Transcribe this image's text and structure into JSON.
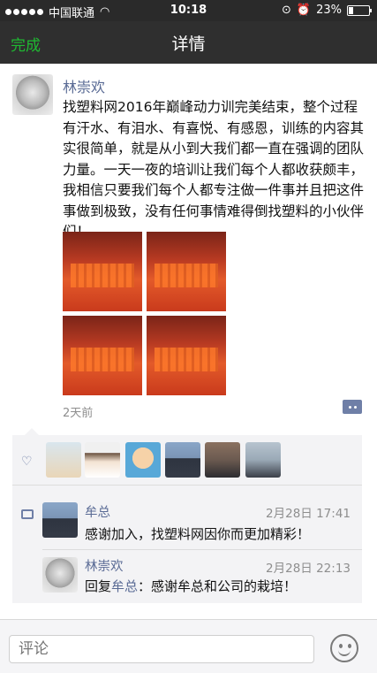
{
  "status": {
    "carrier": "中国联通",
    "time": "10:18",
    "battery": "23%",
    "battery_level": 0.23
  },
  "nav": {
    "back_label": "完成",
    "title": "详情"
  },
  "post": {
    "author": "林崇欢",
    "text": "找塑料网2016年巅峰动力训完美结束，整个过程有汗水、有泪水、有喜悦、有感恩，训练的内容其实很简单，就是从小到大我们都一直在强调的团队力量。一天一夜的培训让我们每个人都收获颇丰，我相信只要我们每个人都专注做一件事并且把这件事做到极致，没有任何事情难得倒找塑料的小伙伴们！",
    "time_ago": "2天前"
  },
  "comments": [
    {
      "name": "牟总",
      "time": "2月28日 17:41",
      "text": "感谢加入，找塑料网因你而更加精彩！"
    },
    {
      "name": "林崇欢",
      "time": "2月28日 22:13",
      "reply_prefix": "回复",
      "reply_to": "牟总",
      "text": "：感谢牟总和公司的栽培！"
    }
  ],
  "input": {
    "placeholder": "评论"
  },
  "colors": {
    "accent_green": "#1fba32",
    "name_blue": "#5a6b95"
  }
}
